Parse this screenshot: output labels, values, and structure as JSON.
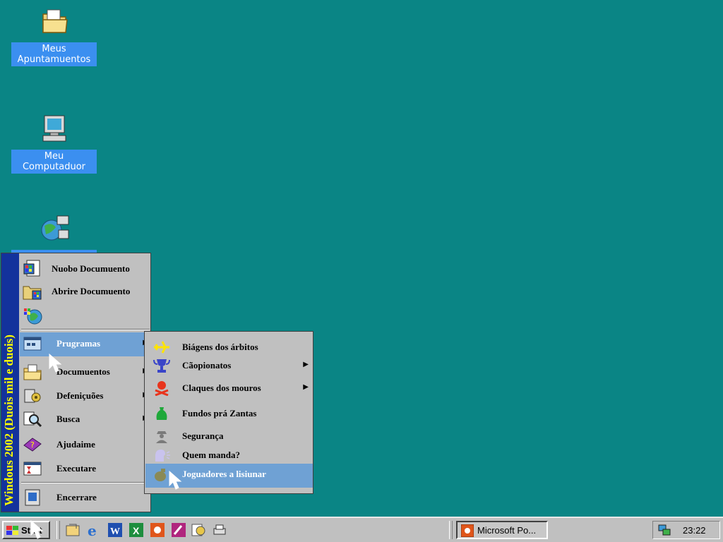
{
  "desktop": {
    "icons": [
      {
        "label_line1": "Meus",
        "label_line2": "Apuntamuentos",
        "icon": "folder-icon"
      },
      {
        "label_line1": "Meu",
        "label_line2": "Computaduor",
        "icon": "computer-icon"
      },
      {
        "label_line1": "",
        "label_line2": "",
        "icon": "network-icon"
      }
    ]
  },
  "start_menu": {
    "banner": "Windous 2002 (Duois mil e duois)",
    "top_items": [
      {
        "label": "Nuobo Documuento",
        "icon": "new-document-icon"
      },
      {
        "label": "Abrire Documuento",
        "icon": "open-document-icon"
      },
      {
        "label": "",
        "icon": "windows-update-icon"
      }
    ],
    "items": [
      {
        "label": "Prugramas",
        "icon": "programs-icon",
        "submenu": true
      },
      {
        "label": "Documuentos",
        "icon": "documents-icon",
        "submenu": true
      },
      {
        "label": "Defeniçuões",
        "icon": "settings-icon",
        "submenu": true
      },
      {
        "label": "Busca",
        "icon": "search-icon",
        "submenu": true
      },
      {
        "label": "Ajudaime",
        "icon": "help-icon",
        "submenu": false
      },
      {
        "label": "Executare",
        "icon": "run-icon",
        "submenu": false
      },
      {
        "label": "Encerrare",
        "icon": "shutdown-icon",
        "submenu": false
      }
    ]
  },
  "submenu": {
    "items": [
      {
        "label": "Biágens dos árbitos",
        "icon": "airplane-icon",
        "submenu": false
      },
      {
        "label": "Cãopionatos",
        "icon": "trophy-icon",
        "submenu": true
      },
      {
        "label": "Claques dos mouros",
        "icon": "skull-icon",
        "submenu": true
      },
      {
        "label": "Fundos prá Zantas",
        "icon": "money-bag-icon",
        "submenu": false
      },
      {
        "label": "Segurança",
        "icon": "guard-icon",
        "submenu": false
      },
      {
        "label": "Quem manda?",
        "icon": "speaking-head-icon",
        "submenu": false
      },
      {
        "label": "Joguadores a lisiunar",
        "icon": "grenade-icon",
        "submenu": false
      }
    ]
  },
  "taskbar": {
    "start_label": "Start",
    "task_label": "Microsoft Po...",
    "clock": "23:22"
  },
  "colors": {
    "desktop": "#0a8585",
    "highlight": "#6fa1d4",
    "banner": "#13329c",
    "banner_text": "#ffff00"
  }
}
